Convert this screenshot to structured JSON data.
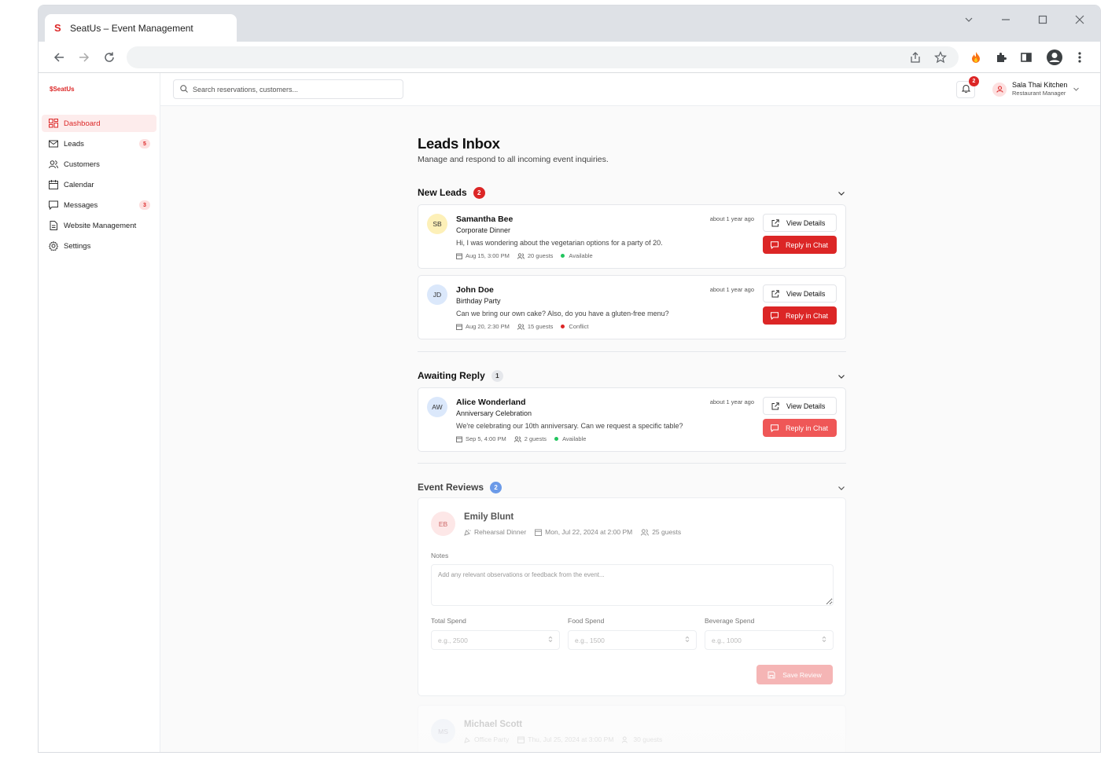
{
  "browser": {
    "tab_title": "SeatUs – Event Management",
    "tab_favicon": "S"
  },
  "app": {
    "logo": "SeatUs",
    "accent": "#dc2626",
    "search_placeholder": "Search reservations, customers...",
    "notifications_count": "2",
    "user": {
      "name": "Sala Thai Kitchen",
      "role": "Restaurant Manager"
    }
  },
  "sidebar": {
    "items": [
      {
        "label": "Dashboard",
        "icon": "grid-icon",
        "active": true,
        "badge": ""
      },
      {
        "label": "Leads",
        "icon": "mail-icon",
        "active": false,
        "badge": "5"
      },
      {
        "label": "Customers",
        "icon": "users-icon",
        "active": false,
        "badge": ""
      },
      {
        "label": "Calendar",
        "icon": "calendar-icon",
        "active": false,
        "badge": ""
      },
      {
        "label": "Messages",
        "icon": "message-icon",
        "active": false,
        "badge": "3"
      },
      {
        "label": "Website Management",
        "icon": "file-icon",
        "active": false,
        "badge": ""
      },
      {
        "label": "Settings",
        "icon": "gear-icon",
        "active": false,
        "badge": ""
      }
    ]
  },
  "page": {
    "title": "Leads Inbox",
    "subtitle": "Manage and respond to all incoming event inquiries."
  },
  "sections": {
    "new_leads": {
      "title": "New Leads",
      "count": "2"
    },
    "awaiting": {
      "title": "Awaiting Reply",
      "count": "1"
    },
    "reviews": {
      "title": "Event Reviews",
      "count": "2"
    }
  },
  "buttons": {
    "view": "View Details",
    "reply": "Reply in Chat",
    "save_review": "Save Review"
  },
  "leads": [
    {
      "initials": "SB",
      "name": "Samantha Bee",
      "event": "Corporate Dinner",
      "message": "Hi, I was wondering about the vegetarian options for a party of 20.",
      "date": "Aug 15, 3:00 PM",
      "guests": "20 guests",
      "status": "Available",
      "status_color": "#22c55e",
      "ago": "about 1 year ago",
      "avatar_bg": "#fdf0b8"
    },
    {
      "initials": "JD",
      "name": "John Doe",
      "event": "Birthday Party",
      "message": "Can we bring our own cake? Also, do you have a gluten-free menu?",
      "date": "Aug 20, 2:30 PM",
      "guests": "15 guests",
      "status": "Conflict",
      "status_color": "#dc2626",
      "ago": "about 1 year ago",
      "avatar_bg": "#dbe8fb"
    }
  ],
  "awaiting_leads": [
    {
      "initials": "AW",
      "name": "Alice Wonderland",
      "event": "Anniversary Celebration",
      "message": "We're celebrating our 10th anniversary. Can we request a specific table?",
      "date": "Sep 5, 4:00 PM",
      "guests": "2 guests",
      "status": "Available",
      "status_color": "#22c55e",
      "ago": "about 1 year ago",
      "avatar_bg": "#dbe8fb"
    }
  ],
  "reviews": [
    {
      "initials": "EB",
      "name": "Emily Blunt",
      "event": "Rehearsal Dinner",
      "date": "Mon, Jul 22, 2024 at 2:00 PM",
      "guests": "25 guests",
      "notes_label": "Notes",
      "notes_placeholder": "Add any relevant observations or feedback from the event...",
      "total_label": "Total Spend",
      "total_placeholder": "e.g., 2500",
      "food_label": "Food Spend",
      "food_placeholder": "e.g., 1500",
      "bev_label": "Beverage Spend",
      "bev_placeholder": "e.g., 1000"
    },
    {
      "initials": "MS",
      "name": "Michael Scott",
      "event": "Office Party",
      "date": "Thu, Jul 25, 2024 at 3:00 PM",
      "guests": "30 guests"
    }
  ]
}
